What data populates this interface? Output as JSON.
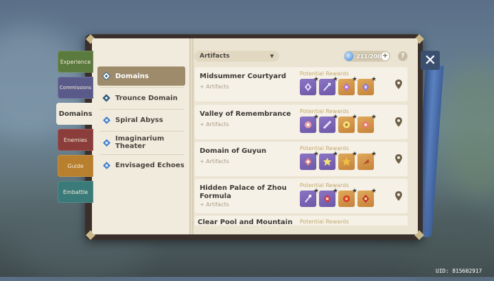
{
  "tabs": [
    {
      "label": "Experience",
      "color": "#5a7a3e"
    },
    {
      "label": "Commissions",
      "color": "#5a5a8a"
    },
    {
      "label": "Domains",
      "color": "#f1ebdd",
      "active": true
    },
    {
      "label": "Enemies",
      "color": "#8a3d3a"
    },
    {
      "label": "Guide",
      "color": "#b8802e"
    },
    {
      "label": "Embattle",
      "color": "#3a7a78"
    }
  ],
  "categories": [
    {
      "label": "Domains",
      "icon": "domain-icon",
      "active": true
    },
    {
      "label": "Trounce Domain",
      "icon": "trounce-domain-icon"
    },
    {
      "label": "Spiral Abyss",
      "icon": "spiral-abyss-icon"
    },
    {
      "label": "Imaginarium\nTheater",
      "icon": "imaginarium-theater-icon"
    },
    {
      "label": "Envisaged Echoes",
      "icon": "envisaged-echoes-icon"
    }
  ],
  "filter": {
    "label": "Artifacts"
  },
  "resin": {
    "value": "211/200"
  },
  "rewards_label": "Potential Rewards",
  "domains": [
    {
      "name": "Midsummer Courtyard",
      "sub": "+ Artifacts",
      "rewards": [
        "p",
        "p",
        "o",
        "o"
      ]
    },
    {
      "name": "Valley of Remembrance",
      "sub": "+ Artifacts",
      "rewards": [
        "p",
        "p",
        "o",
        "o"
      ]
    },
    {
      "name": "Domain of Guyun",
      "sub": "+ Artifacts",
      "rewards": [
        "p",
        "p",
        "o",
        "o"
      ]
    },
    {
      "name": "Hidden Palace of Zhou Formula",
      "sub": "+ Artifacts",
      "rewards": [
        "p",
        "o",
        "o",
        "o"
      ]
    },
    {
      "name": "Clear Pool and Mountain",
      "sub": "",
      "rewards": []
    }
  ],
  "uid": "UID: 815602917"
}
